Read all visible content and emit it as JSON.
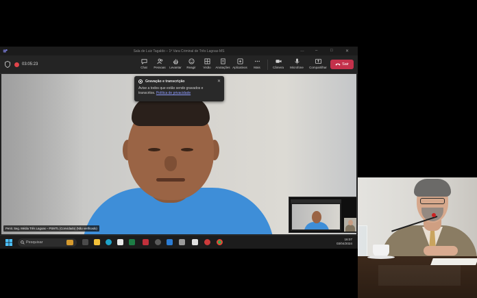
{
  "window": {
    "title": "Sala de Luiz Tagaldo – 1ª Vara Criminal de Três Lagoas-MS",
    "controls": [
      "…",
      "–",
      "□",
      "✕"
    ]
  },
  "toolbar": {
    "timer": "03:05:23",
    "buttons": [
      {
        "label": "Chat",
        "icon": "chat-icon"
      },
      {
        "label": "Pessoas",
        "icon": "people-icon"
      },
      {
        "label": "Levantar",
        "icon": "raise-hand-icon"
      },
      {
        "label": "Reagir",
        "icon": "react-icon"
      },
      {
        "label": "Visão",
        "icon": "view-icon"
      },
      {
        "label": "Anotações",
        "icon": "notes-icon"
      },
      {
        "label": "Aplicativos",
        "icon": "apps-icon"
      },
      {
        "label": "Mais",
        "icon": "more-icon"
      },
      {
        "label": "Câmera",
        "icon": "camera-icon"
      },
      {
        "label": "Microfone",
        "icon": "microphone-icon"
      },
      {
        "label": "Compartilhar",
        "icon": "share-icon"
      }
    ],
    "leave_label": "Sair",
    "accent": "#c4314b"
  },
  "recording_popup": {
    "title": "Gravação e transcrição",
    "body": "Avise a todos que estão sendo gravados e transcritos.",
    "link": "Política de privacidade"
  },
  "participant": {
    "name_tag": "Penit. Seg. Média Três Lagoas – PSMTL (Convidado) (Não verificado)"
  },
  "taskbar": {
    "search_placeholder": "Pesquisar",
    "time": "16:07",
    "date": "03/04/2024",
    "apps": [
      "task-view-icon",
      "file-explorer-icon",
      "edge-icon",
      "store-icon",
      "excel-icon",
      "word-icon",
      "teams-icon",
      "chrome-icon",
      "outlook-icon",
      "maps-icon",
      "notepad-icon",
      "pdf-icon",
      "obs-icon",
      "chrome-alt-icon"
    ]
  }
}
